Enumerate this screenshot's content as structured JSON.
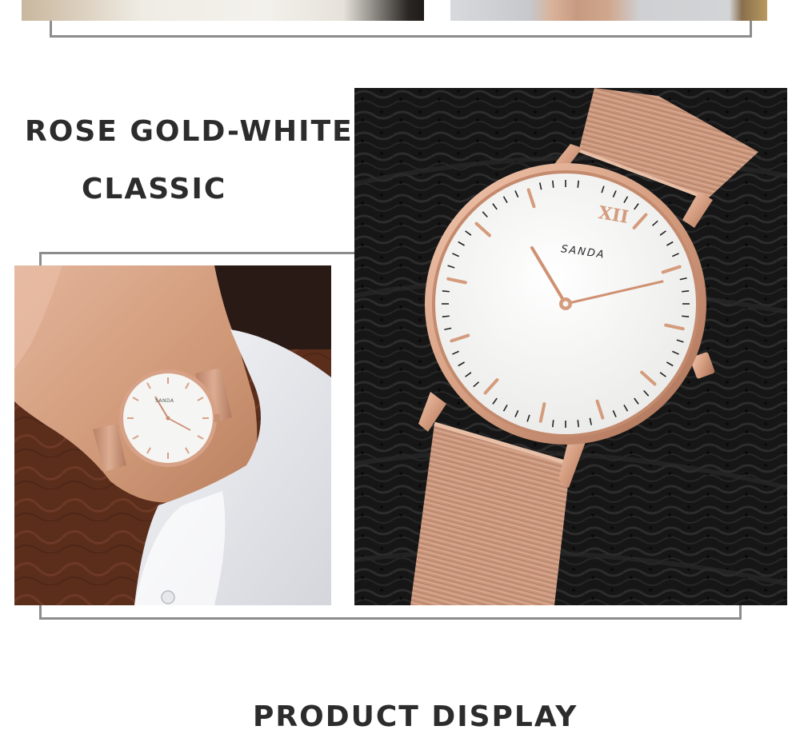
{
  "headline": {
    "line1": "ROSE GOLD-WHITE",
    "line2": "CLASSIC"
  },
  "footer": {
    "title": "PRODUCT DISPLAY"
  },
  "brand": {
    "dial_logo": "SANDA",
    "numeral": "XII"
  },
  "colors": {
    "rose_gold": "#d9a384",
    "dial_white": "#f5f5f4",
    "frame_gray": "#8c8c8c",
    "text_dark": "#2c2c2c"
  }
}
